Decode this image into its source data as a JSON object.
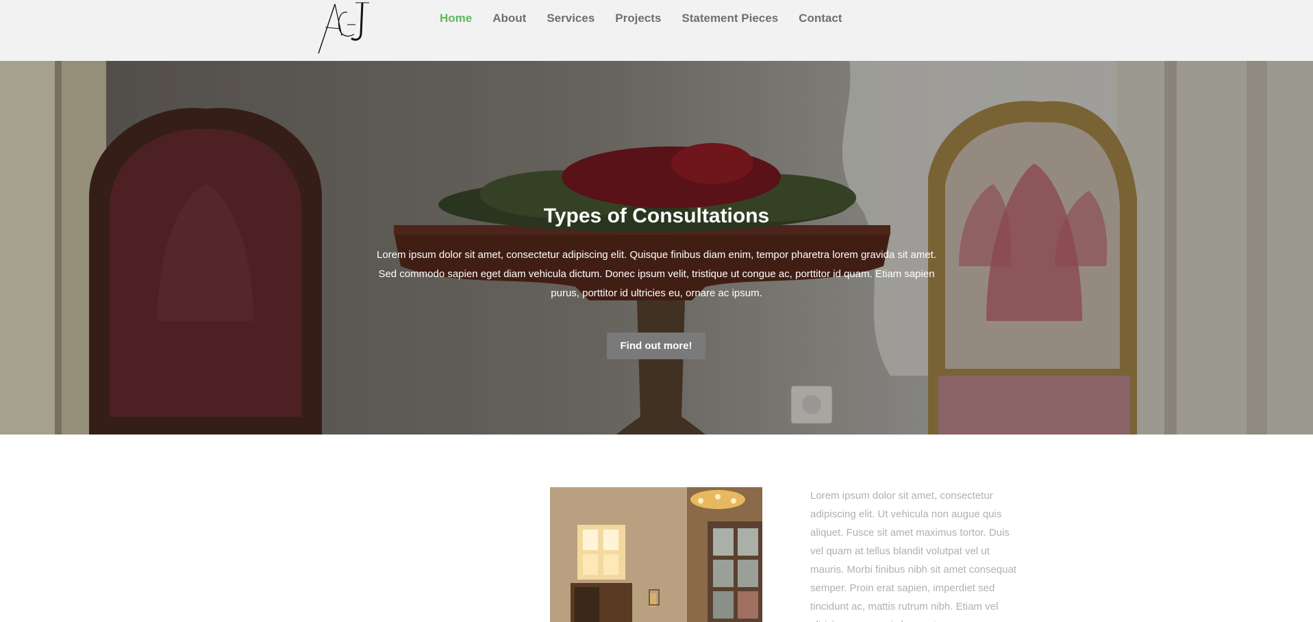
{
  "logo": {
    "text": "AGJ",
    "icon": "agj-monogram-logo"
  },
  "nav": {
    "items": [
      {
        "label": "Home",
        "active": true
      },
      {
        "label": "About",
        "active": false
      },
      {
        "label": "Services",
        "active": false
      },
      {
        "label": "Projects",
        "active": false
      },
      {
        "label": "Statement Pieces",
        "active": false
      },
      {
        "label": "Contact",
        "active": false
      }
    ]
  },
  "hero": {
    "title": "Types of Consultations",
    "text": "Lorem ipsum dolor sit amet, consectetur adipiscing elit. Quisque finibus diam enim, tempor pharetra lorem gravida sit amet. Sed commodo sapien eget diam vehicula dictum. Donec ipsum velit, tristique ut congue ac, porttitor id quam. Etiam sapien purus, porttitor id ultricies eu, ornare ac ipsum.",
    "button_label": "Find out more!",
    "image": "antique-chairs-and-console-table-photo"
  },
  "content": {
    "image": "sunlit-room-with-chandelier-photo",
    "text": "Lorem ipsum dolor sit amet, consectetur adipiscing elit. Ut vehicula non augue quis aliquet. Fusce sit amet maximus tortor. Duis vel quam at tellus blandit volutpat vel ut mauris. Morbi finibus nibh sit amet consequat semper. Proin erat sapien, imperdiet sed tincidunt ac, mattis rutrum nibh. Etiam vel ultricies quam, quis lacus at."
  },
  "colors": {
    "header_bg": "#f2f2f2",
    "nav_text": "#6f6f6f",
    "nav_active": "#5cb85c",
    "button_bg": "#7a7a7a",
    "body_text_muted": "#b0b0b0"
  }
}
